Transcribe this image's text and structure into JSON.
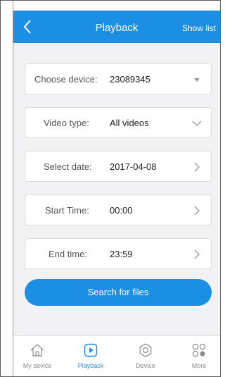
{
  "header": {
    "title": "Playback",
    "show_list_label": "Show list"
  },
  "form": {
    "device": {
      "label": "Choose device:",
      "value": "23089345"
    },
    "video_type": {
      "label": "Video type:",
      "value": "All videos"
    },
    "date": {
      "label": "Select date:",
      "value": "2017-04-08"
    },
    "start_time": {
      "label": "Start Time:",
      "value": "00:00"
    },
    "end_time": {
      "label": "End time:",
      "value": "23:59"
    }
  },
  "search_label": "Search for files",
  "tabs": [
    {
      "label": "My device",
      "icon": "home-icon",
      "active": false
    },
    {
      "label": "Playback",
      "icon": "play-icon",
      "active": true
    },
    {
      "label": "Device",
      "icon": "settings-icon",
      "active": false
    },
    {
      "label": "More",
      "icon": "more-icon",
      "active": false
    }
  ],
  "colors": {
    "accent": "#1a8fe3",
    "background": "#f2f2f4",
    "inactive": "#8a8a8a"
  }
}
